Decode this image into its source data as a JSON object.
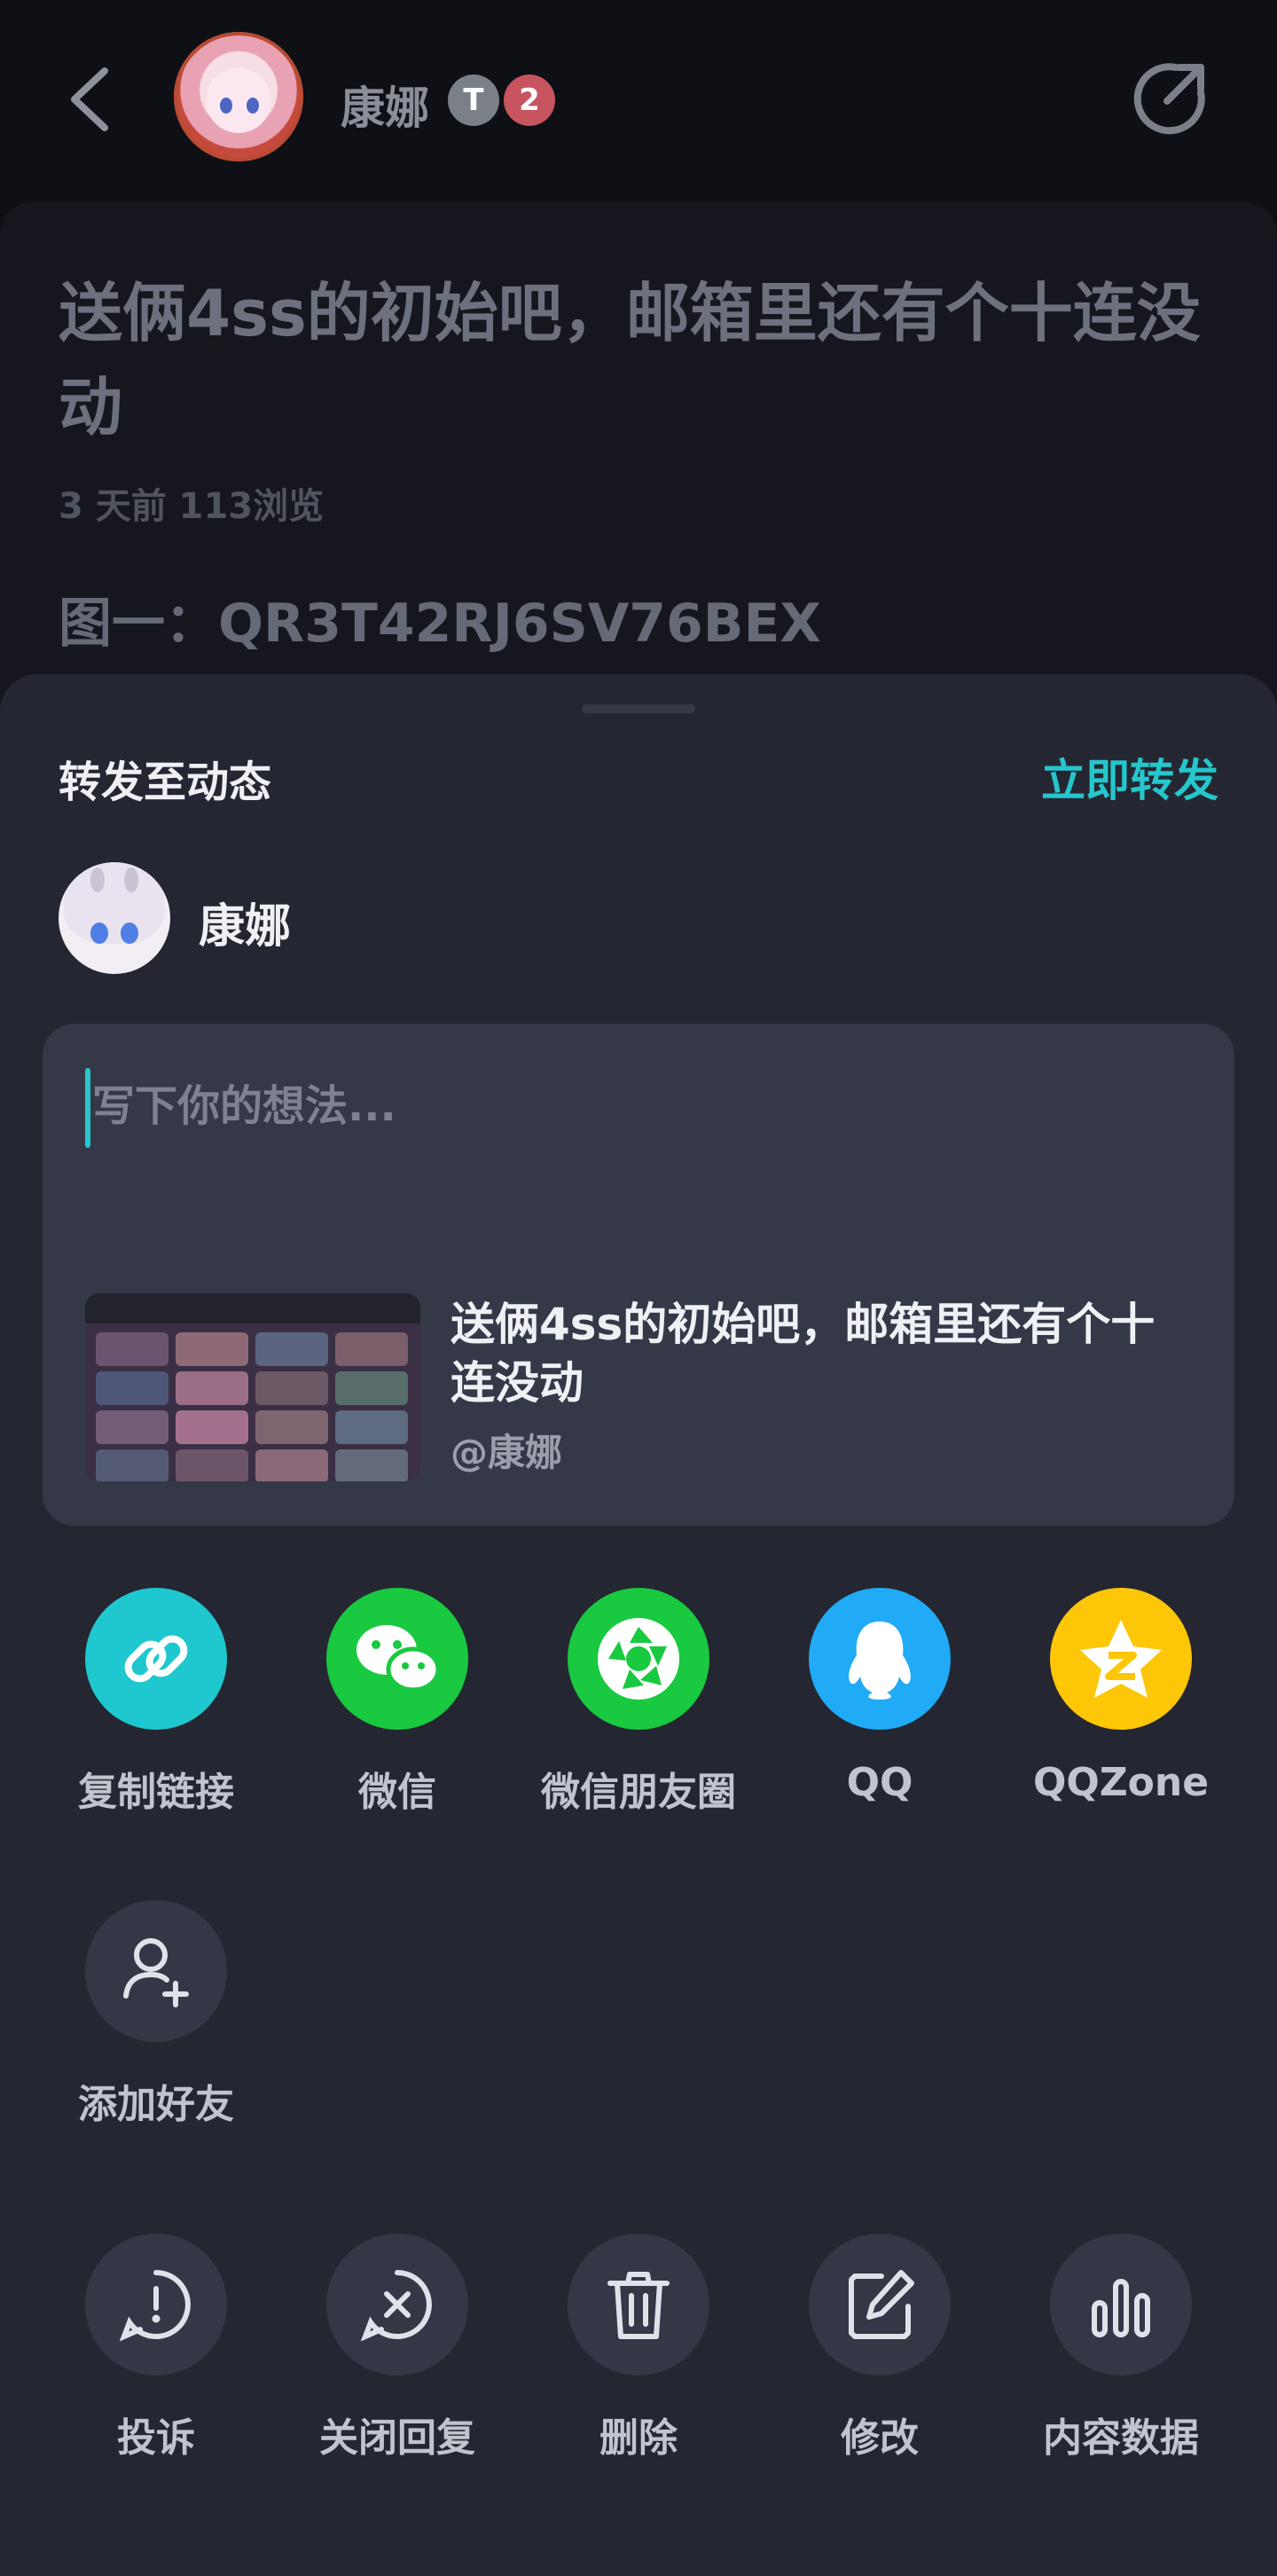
{
  "header": {
    "username": "康娜",
    "badge_t": "T",
    "badge_level": "2"
  },
  "post": {
    "title": "送俩4ss的初始吧，邮箱里还有个十连没动",
    "meta": "3 天前   113浏览",
    "code_line": "图一：QR3T42RJ6SV76BEX"
  },
  "sheet": {
    "title": "转发至动态",
    "forward_now": "立即转发",
    "user_name": "康娜",
    "input_placeholder": "写下你的想法...",
    "ref_title": "送俩4ss的初始吧，邮箱里还有个十连没动",
    "ref_author": "@康娜"
  },
  "share_targets": [
    {
      "label": "复制链接",
      "icon": "link-icon",
      "color": "#1fc7cf"
    },
    {
      "label": "微信",
      "icon": "wechat-icon",
      "color": "#19c940"
    },
    {
      "label": "微信朋友圈",
      "icon": "moments-icon",
      "color": "#19c940"
    },
    {
      "label": "QQ",
      "icon": "qq-icon",
      "color": "#21aaf5"
    },
    {
      "label": "QQZone",
      "icon": "qzone-icon",
      "color": "#fdc607"
    }
  ],
  "extra_targets": [
    {
      "label": "添加好友",
      "icon": "add-friend-icon"
    }
  ],
  "actions": [
    {
      "label": "投诉",
      "icon": "report-icon"
    },
    {
      "label": "关闭回复",
      "icon": "close-reply-icon"
    },
    {
      "label": "删除",
      "icon": "trash-icon"
    },
    {
      "label": "修改",
      "icon": "edit-icon"
    },
    {
      "label": "内容数据",
      "icon": "stats-icon"
    }
  ]
}
